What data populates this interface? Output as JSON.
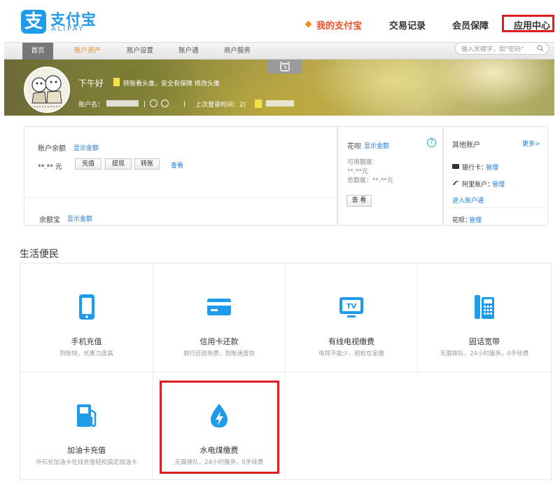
{
  "header": {
    "logo_cn": "支付宝",
    "logo_en": "ALIPAY",
    "logo_mark": "支",
    "nav": [
      {
        "label": "我的支付宝",
        "active": true
      },
      {
        "label": "交易记录",
        "active": false
      },
      {
        "label": "会员保障",
        "active": false
      },
      {
        "label": "应用中心",
        "active": false,
        "highlighted": true
      }
    ]
  },
  "subnav": {
    "items": [
      "首页",
      "账户资产",
      "账户设置",
      "账户通",
      "商户服务"
    ],
    "search_placeholder": "输入关键字，如\"密码\""
  },
  "banner": {
    "greeting": "下午好",
    "tip": "转账看头像，安全有保障 修改头像",
    "account_label": "账户名：",
    "login_label": "上次登录时间：",
    "login_value_prefix": "2("
  },
  "balance": {
    "title": "账户余额",
    "show_amount": "显示金额",
    "masked_value": "**.** 元",
    "buttons": [
      "充值",
      "提现",
      "转账"
    ],
    "view_link": "查看"
  },
  "yuebao": {
    "title": "余额宝",
    "show_amount": "显示金额"
  },
  "huabei": {
    "title": "花呗",
    "show_amount": "显示金额",
    "help": "?",
    "available_label": "可用额度",
    "available_value": "**.**元",
    "total_label": "总额度：",
    "total_value": "**.**元",
    "view_button": "查 看"
  },
  "other_accounts": {
    "title": "其他账户",
    "more_link": "更多>",
    "bank_card_label": "银行卡：",
    "bank_card_link": "管理",
    "ali_label": "阿里账户：",
    "ali_link": "管理",
    "account_link": "进入账户通",
    "huabei_label": "花呗：",
    "huabei_link": "管理"
  },
  "life": {
    "title": "生活便民",
    "services": [
      {
        "name": "手机充值",
        "desc": "到账快，优惠力度高",
        "icon": "mobile-phone-icon"
      },
      {
        "name": "信用卡还款",
        "desc": "跨行还款免费，到账速度快",
        "icon": "credit-card-icon"
      },
      {
        "name": "有线电视缴费",
        "desc": "电视不能少，轻松在家缴",
        "icon": "tv-icon"
      },
      {
        "name": "固话宽带",
        "desc": "无需排队，24小时服务，0手续费",
        "icon": "telephone-icon"
      },
      {
        "name": "加油卡充值",
        "desc": "中石化加油卡在线充值轻松搞定加油卡",
        "icon": "gas-pump-icon"
      },
      {
        "name": "水电煤缴费",
        "desc": "无需排队，24小时服务，0手续费",
        "icon": "water-drop-lightning-icon",
        "highlighted": true
      }
    ]
  },
  "colors": {
    "brand_blue": "#1e9be9",
    "accent_orange": "#f08a24",
    "active_red": "#e8532b",
    "highlight_red": "#dc1e23"
  }
}
